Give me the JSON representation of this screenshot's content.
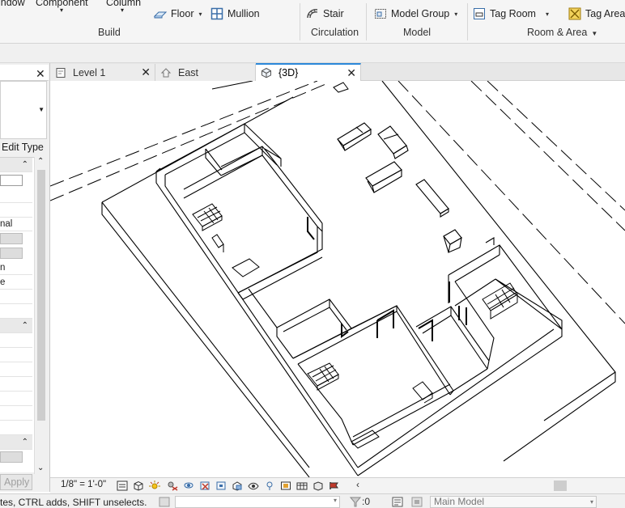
{
  "ribbon": {
    "window_label": "indow",
    "component_label": "Component",
    "column_label": "Column",
    "floor_label": "Floor",
    "mullion_label": "Mullion",
    "stair_label": "Stair",
    "model_group_label": "Model  Group",
    "tag_room_label": "Tag  Room",
    "tag_area_label": "Tag  Area",
    "panels": {
      "build": "Build",
      "circulation": "Circulation",
      "model": "Model",
      "room_area": "Room & Area"
    }
  },
  "properties": {
    "edit_type_label": "Edit Type",
    "row_nal": "nal",
    "row_n": "n",
    "row_e": "e",
    "apply_label": "Apply"
  },
  "tabs": [
    {
      "label": "Level 1",
      "icon": "floor-plan-icon",
      "active": false
    },
    {
      "label": "East",
      "icon": "elevation-icon",
      "active": false
    },
    {
      "label": "{3D}",
      "icon": "3d-view-icon",
      "active": true
    }
  ],
  "view_bar": {
    "scale": "1/8\" = 1'-0\""
  },
  "status_bar": {
    "message": "tes, CTRL adds, SHIFT unselects.",
    "filter_count": ":0",
    "model_label": "Main Model"
  },
  "colors": {
    "active_tab_accent": "#2c88d9",
    "ribbon_bg": "#f5f5f5"
  }
}
